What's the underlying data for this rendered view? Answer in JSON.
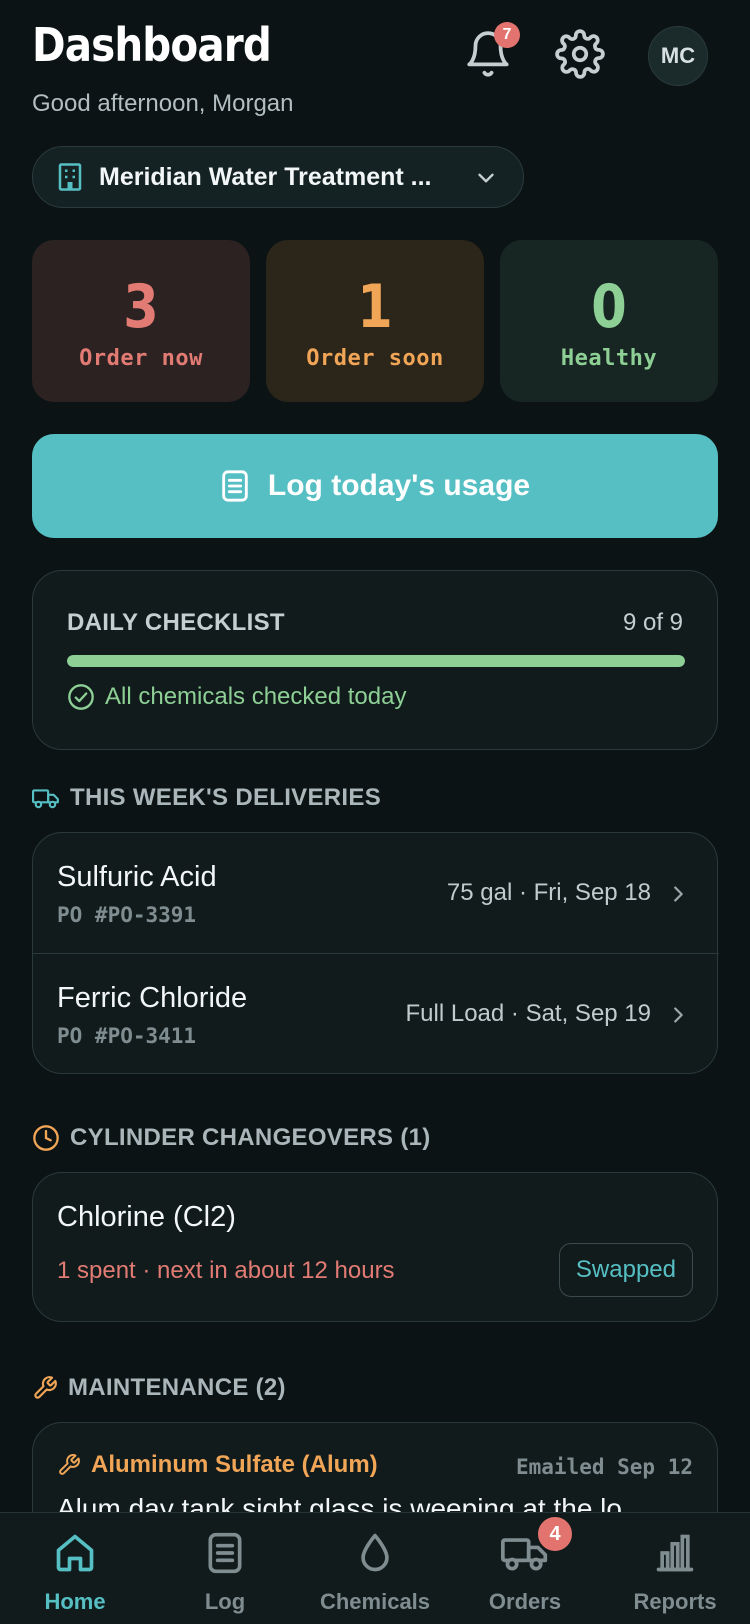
{
  "header": {
    "title": "Dashboard",
    "greeting": "Good afternoon, Morgan",
    "notifications_count": "7",
    "avatar_initials": "MC"
  },
  "facility": {
    "name": "Meridian Water Treatment ..."
  },
  "stats": [
    {
      "value": "3",
      "label": "Order now",
      "color": "#e27b73"
    },
    {
      "value": "1",
      "label": "Order soon",
      "color": "#f0a557"
    },
    {
      "value": "0",
      "label": "Healthy",
      "color": "#8dcf95"
    }
  ],
  "log_button": {
    "label": "Log today's usage"
  },
  "checklist": {
    "title": "DAILY CHECKLIST",
    "count": "9 of 9",
    "progress_fraction": 1.0,
    "status": "All chemicals checked today"
  },
  "deliveries": {
    "heading": "THIS WEEK'S DELIVERIES",
    "items": [
      {
        "name": "Sulfuric Acid",
        "po": "PO #PO-3391",
        "meta": "75 gal · Fri, Sep 18"
      },
      {
        "name": "Ferric Chloride",
        "po": "PO #PO-3411",
        "meta": "Full Load · Sat, Sep 19"
      }
    ]
  },
  "cylinders": {
    "heading": "CYLINDER CHANGEOVERS (1)",
    "item": {
      "name": "Chlorine (Cl2)",
      "status": "1 spent · next in about 12 hours",
      "action": "Swapped"
    }
  },
  "maintenance": {
    "heading": "MAINTENANCE (2)",
    "item": {
      "name": "Aluminum Sulfate (Alum)",
      "date": "Emailed Sep 12",
      "description": "Alum day tank sight glass is weeping at the lo"
    }
  },
  "tabs": [
    {
      "label": "Home",
      "icon": "home-icon",
      "active": true
    },
    {
      "label": "Log",
      "icon": "log-icon",
      "active": false
    },
    {
      "label": "Chemicals",
      "icon": "droplet-icon",
      "active": false
    },
    {
      "label": "Orders",
      "icon": "truck-icon",
      "active": false,
      "badge": "4"
    },
    {
      "label": "Reports",
      "icon": "bar-chart-icon",
      "active": false
    }
  ],
  "colors": {
    "accent": "#56bfc3",
    "danger": "#e27b73",
    "warning": "#f0a557",
    "success": "#8dcf95",
    "background": "#0b1314"
  }
}
